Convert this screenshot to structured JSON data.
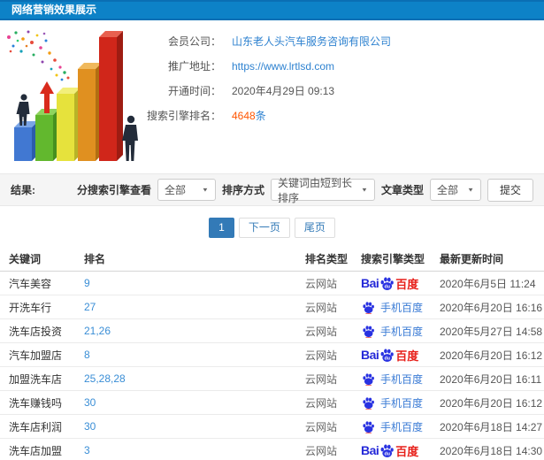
{
  "header": {
    "title": "网络营销效果展示"
  },
  "info": {
    "company_label": "会员公司：",
    "company_value": "山东老人头汽车服务咨询有限公司",
    "url_label": "推广地址：",
    "url_value": "https://www.lrtlsd.com",
    "open_label": "开通时间：",
    "open_value": "2020年4月29日 09:13",
    "rank_label": "搜索引擎排名：",
    "rank_value": "4648",
    "rank_suffix": "条"
  },
  "filters": {
    "result_label": "结果:",
    "engine_label": "分搜索引擎查看",
    "engine_value": "全部",
    "sort_label": "排序方式",
    "sort_value": "关键词由短到长排序",
    "article_label": "文章类型",
    "article_value": "全部",
    "submit_label": "提交"
  },
  "pagination": {
    "current": "1",
    "next_label": "下一页",
    "last_label": "尾页"
  },
  "table": {
    "headers": [
      "关键词",
      "排名",
      "排名类型",
      "搜索引擎类型",
      "最新更新时间"
    ],
    "rows": [
      {
        "keyword": "汽车美容",
        "rank": "9",
        "rank_type": "云网站",
        "engine": "baidu",
        "time": "2020年6月5日 11:24"
      },
      {
        "keyword": "开洗车行",
        "rank": "27",
        "rank_type": "云网站",
        "engine": "mobile",
        "time": "2020年6月20日 16:16"
      },
      {
        "keyword": "洗车店投资",
        "rank": "21,26",
        "rank_type": "云网站",
        "engine": "mobile",
        "time": "2020年5月27日 14:58"
      },
      {
        "keyword": "汽车加盟店",
        "rank": "8",
        "rank_type": "云网站",
        "engine": "baidu",
        "time": "2020年6月20日 16:12"
      },
      {
        "keyword": "加盟洗车店",
        "rank": "25,28,28",
        "rank_type": "云网站",
        "engine": "mobile",
        "time": "2020年6月20日 16:11"
      },
      {
        "keyword": "洗车赚钱吗",
        "rank": "30",
        "rank_type": "云网站",
        "engine": "mobile",
        "time": "2020年6月20日 16:12"
      },
      {
        "keyword": "洗车店利润",
        "rank": "30",
        "rank_type": "云网站",
        "engine": "mobile",
        "time": "2020年6月18日 14:27"
      },
      {
        "keyword": "洗车店加盟",
        "rank": "3",
        "rank_type": "云网站",
        "engine": "baidu",
        "time": "2020年6月18日 14:30"
      }
    ]
  },
  "engines": {
    "baidu": {
      "bai": "Bai",
      "du": "du",
      "cn": "百度"
    },
    "mobile": {
      "label": "手机百度"
    }
  },
  "icons": {
    "dropdown_caret": "▼"
  },
  "colors": {
    "header_blue": "#0d82c7",
    "link_blue": "#2e82d0",
    "rank_blue": "#3a8ed6",
    "highlight_orange": "#ff5500",
    "pager_active_blue": "#337ab7",
    "baidu_word_blue": "#2529d8",
    "baidu_red": "#e71f19",
    "baidu_icon_blue": "#2932e1",
    "filter_bar_bg": "#f5f5f5"
  }
}
